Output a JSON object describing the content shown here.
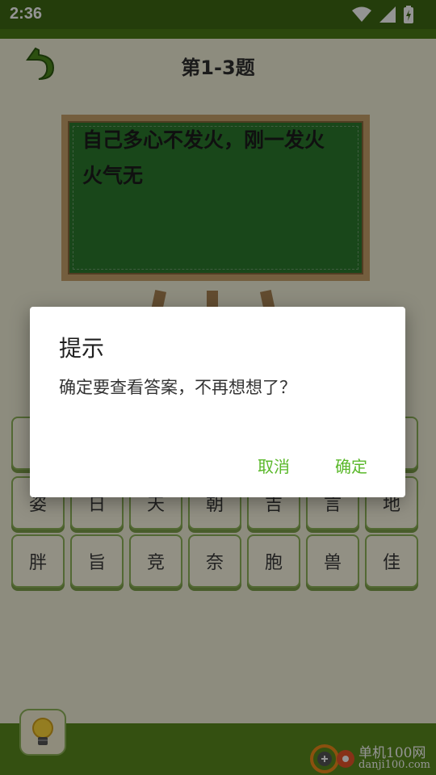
{
  "status": {
    "time": "2:36"
  },
  "header": {
    "title": "第1-3题"
  },
  "board": {
    "line1": "自己多心不发火，刚一发火",
    "line2": "火气无"
  },
  "grid": {
    "row1": [
      "",
      "",
      "",
      "",
      "",
      "",
      ""
    ],
    "row2": [
      "姿",
      "日",
      "天",
      "朝",
      "吉",
      "言",
      "地"
    ],
    "row3": [
      "胖",
      "旨",
      "竞",
      "奈",
      "胞",
      "兽",
      "佳"
    ]
  },
  "dialog": {
    "title": "提示",
    "message": "确定要查看答案，不再想想了？",
    "cancel": "取消",
    "ok": "确定"
  },
  "watermark": {
    "cn": "单机100网",
    "url": "danji100.com"
  },
  "colors": {
    "board": "#2c7a2e",
    "accent": "#5ab82a",
    "bar": "#3f6a14"
  }
}
